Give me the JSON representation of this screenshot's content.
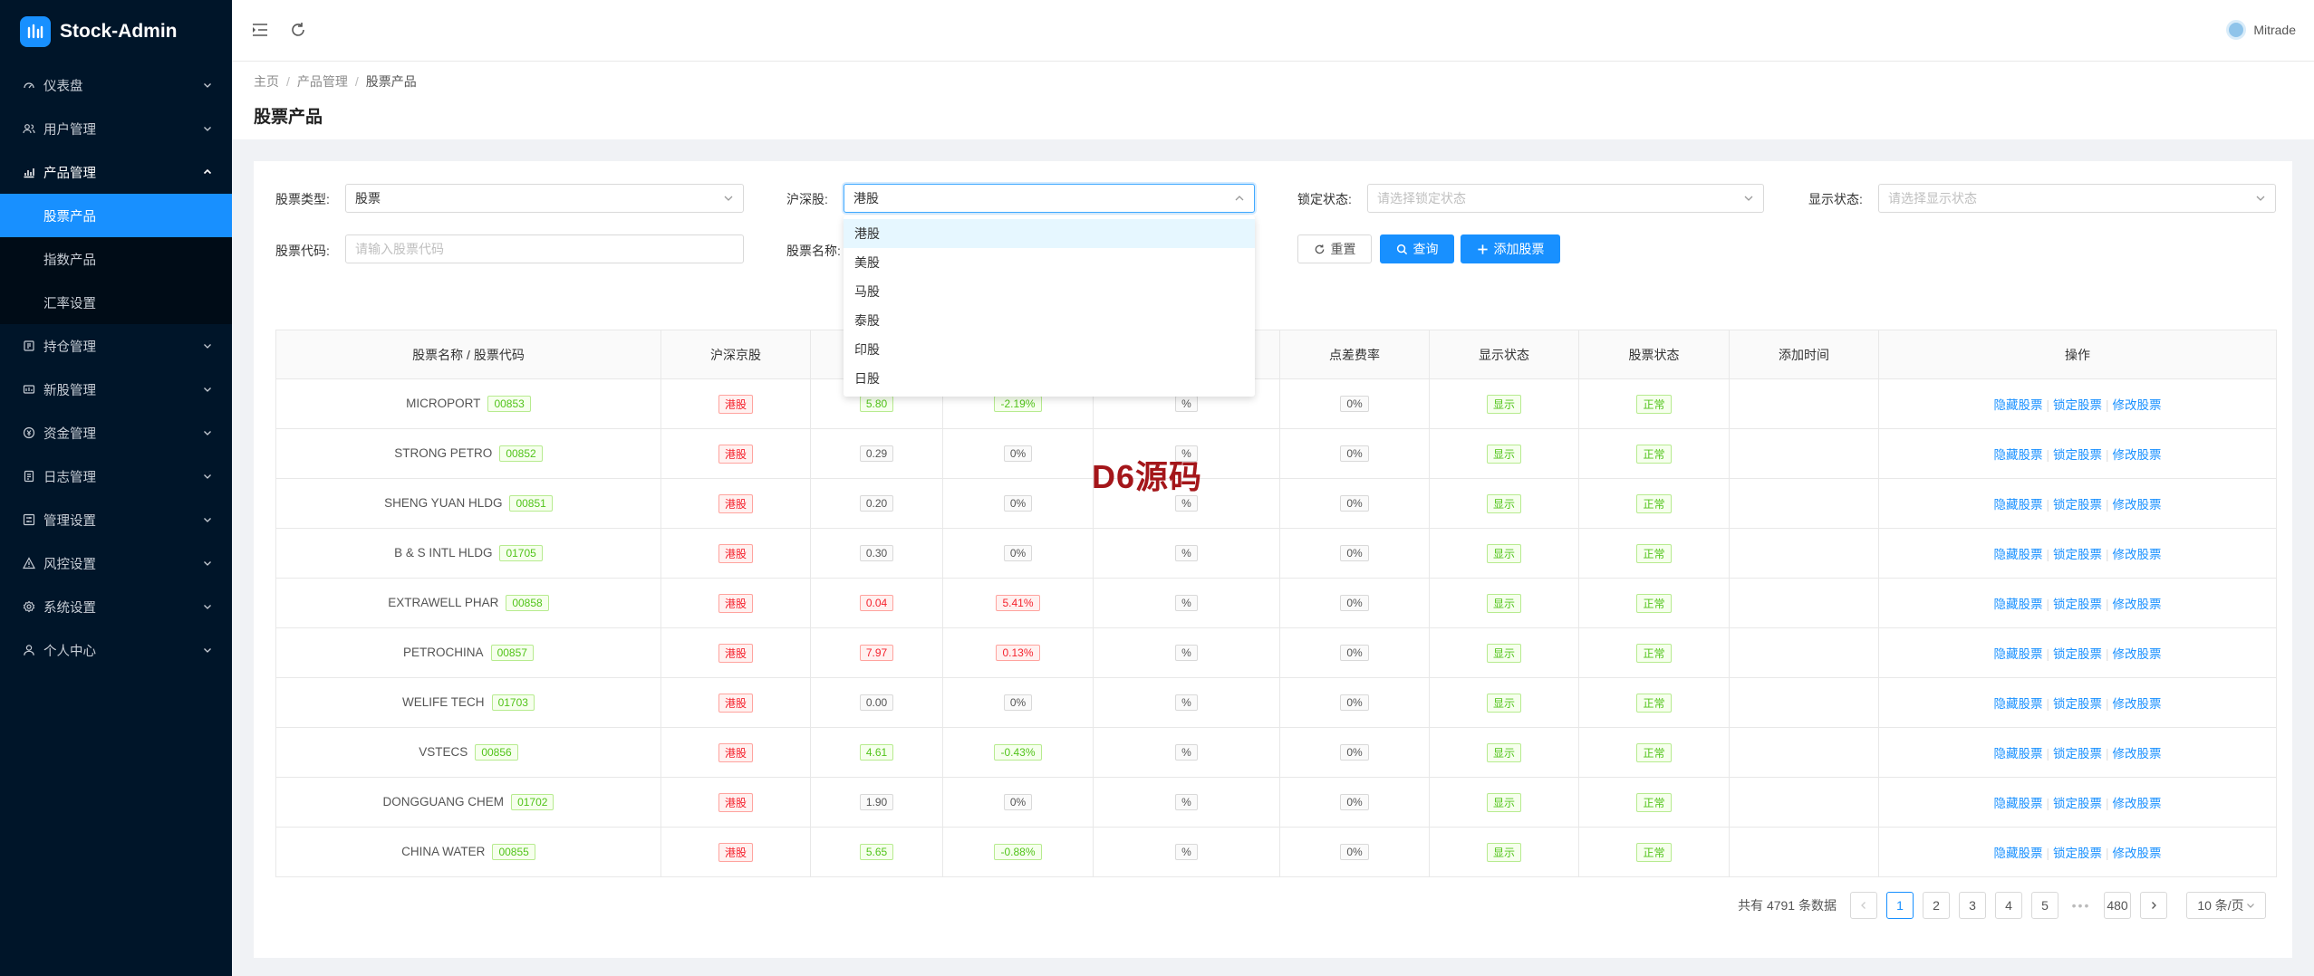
{
  "app": {
    "title": "Stock-Admin"
  },
  "user": {
    "name": "Mitrade"
  },
  "sidebar": {
    "items": [
      {
        "label": "仪表盘",
        "icon": "dashboard-icon"
      },
      {
        "label": "用户管理",
        "icon": "users-icon"
      },
      {
        "label": "产品管理",
        "icon": "chart-icon",
        "open": true,
        "children": [
          {
            "label": "股票产品",
            "active": true
          },
          {
            "label": "指数产品"
          },
          {
            "label": "汇率设置"
          }
        ]
      },
      {
        "label": "持仓管理",
        "icon": "position-icon"
      },
      {
        "label": "新股管理",
        "icon": "ipo-icon"
      },
      {
        "label": "资金管理",
        "icon": "money-icon"
      },
      {
        "label": "日志管理",
        "icon": "log-icon"
      },
      {
        "label": "管理设置",
        "icon": "settings-icon"
      },
      {
        "label": "风控设置",
        "icon": "warning-icon"
      },
      {
        "label": "系统设置",
        "icon": "gear-icon"
      },
      {
        "label": "个人中心",
        "icon": "person-icon"
      }
    ]
  },
  "breadcrumb": [
    "主页",
    "产品管理",
    "股票产品"
  ],
  "page_title": "股票产品",
  "filters": {
    "stock_type": {
      "label": "股票类型:",
      "value": "股票"
    },
    "market": {
      "label": "沪深股:",
      "value": "港股"
    },
    "lock_status": {
      "label": "锁定状态:",
      "placeholder": "请选择锁定状态"
    },
    "display_status": {
      "label": "显示状态:",
      "placeholder": "请选择显示状态"
    },
    "stock_code": {
      "label": "股票代码:",
      "placeholder": "请输入股票代码"
    },
    "stock_name": {
      "label": "股票名称:"
    }
  },
  "buttons": {
    "reset": "重置",
    "query": "查询",
    "add": "添加股票"
  },
  "dropdown": {
    "options": [
      "港股",
      "美股",
      "马股",
      "泰股",
      "印股",
      "日股"
    ],
    "selected": "港股"
  },
  "table": {
    "columns": [
      "股票名称 / 股票代码",
      "沪深京股",
      "",
      "",
      "",
      "点差费率",
      "显示状态",
      "股票状态",
      "添加时间",
      "操作"
    ],
    "rows": [
      {
        "name": "MICROPORT",
        "code": "00853",
        "market": "港股",
        "price": "5.80",
        "change": "-2.19%",
        "pct": "%",
        "spread": "0%",
        "display": "显示",
        "status": "正常",
        "trend": "down"
      },
      {
        "name": "STRONG PETRO",
        "code": "00852",
        "market": "港股",
        "price": "0.29",
        "change": "0%",
        "pct": "%",
        "spread": "0%",
        "display": "显示",
        "status": "正常",
        "trend": "flat"
      },
      {
        "name": "SHENG YUAN HLDG",
        "code": "00851",
        "market": "港股",
        "price": "0.20",
        "change": "0%",
        "pct": "%",
        "spread": "0%",
        "display": "显示",
        "status": "正常",
        "trend": "flat"
      },
      {
        "name": "B & S INTL HLDG",
        "code": "01705",
        "market": "港股",
        "price": "0.30",
        "change": "0%",
        "pct": "%",
        "spread": "0%",
        "display": "显示",
        "status": "正常",
        "trend": "flat"
      },
      {
        "name": "EXTRAWELL PHAR",
        "code": "00858",
        "market": "港股",
        "price": "0.04",
        "change": "5.41%",
        "pct": "%",
        "spread": "0%",
        "display": "显示",
        "status": "正常",
        "trend": "up"
      },
      {
        "name": "PETROCHINA",
        "code": "00857",
        "market": "港股",
        "price": "7.97",
        "change": "0.13%",
        "pct": "%",
        "spread": "0%",
        "display": "显示",
        "status": "正常",
        "trend": "up"
      },
      {
        "name": "WELIFE TECH",
        "code": "01703",
        "market": "港股",
        "price": "0.00",
        "change": "0%",
        "pct": "%",
        "spread": "0%",
        "display": "显示",
        "status": "正常",
        "trend": "flat"
      },
      {
        "name": "VSTECS",
        "code": "00856",
        "market": "港股",
        "price": "4.61",
        "change": "-0.43%",
        "pct": "%",
        "spread": "0%",
        "display": "显示",
        "status": "正常",
        "trend": "down"
      },
      {
        "name": "DONGGUANG CHEM",
        "code": "01702",
        "market": "港股",
        "price": "1.90",
        "change": "0%",
        "pct": "%",
        "spread": "0%",
        "display": "显示",
        "status": "正常",
        "trend": "flat"
      },
      {
        "name": "CHINA WATER",
        "code": "00855",
        "market": "港股",
        "price": "5.65",
        "change": "-0.88%",
        "pct": "%",
        "spread": "0%",
        "display": "显示",
        "status": "正常",
        "trend": "down"
      }
    ],
    "actions": [
      "隐藏股票",
      "锁定股票",
      "修改股票"
    ]
  },
  "watermark": "D6源码",
  "pagination": {
    "total_text": "共有 4791 条数据",
    "pages": [
      "1",
      "2",
      "3",
      "4",
      "5"
    ],
    "ellipsis": "•••",
    "last": "480",
    "current": "1",
    "page_size": "10 条/页"
  },
  "colors": {
    "primary": "#1890ff",
    "sidebar_bg": "#001529",
    "up": "#f5222d",
    "down": "#52c41a"
  }
}
